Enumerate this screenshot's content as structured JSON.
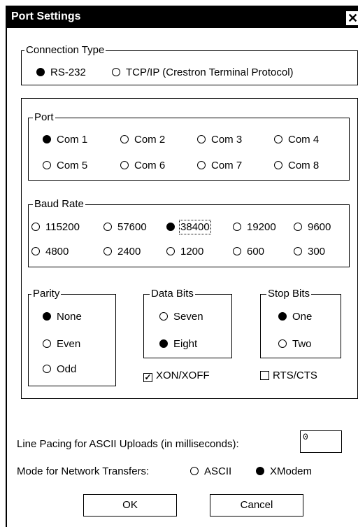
{
  "window": {
    "title": "Port Settings",
    "close_glyph": "✕"
  },
  "connection_type": {
    "legend": "Connection Type",
    "options": [
      "RS-232",
      "TCP/IP (Crestron Terminal Protocol)"
    ],
    "selected": "RS-232"
  },
  "port": {
    "legend": "Port",
    "options": [
      "Com 1",
      "Com 2",
      "Com 3",
      "Com 4",
      "Com 5",
      "Com 6",
      "Com 7",
      "Com 8"
    ],
    "selected": "Com 1"
  },
  "baud_rate": {
    "legend": "Baud Rate",
    "options": [
      "115200",
      "57600",
      "38400",
      "19200",
      "9600",
      "4800",
      "2400",
      "1200",
      "600",
      "300"
    ],
    "selected": "38400"
  },
  "parity": {
    "legend": "Parity",
    "options": [
      "None",
      "Even",
      "Odd"
    ],
    "selected": "None"
  },
  "data_bits": {
    "legend": "Data Bits",
    "options": [
      "Seven",
      "Eight"
    ],
    "selected": "Eight"
  },
  "stop_bits": {
    "legend": "Stop Bits",
    "options": [
      "One",
      "Two"
    ],
    "selected": "One"
  },
  "flow_control": {
    "xon_xoff": {
      "label": "XON/XOFF",
      "checked": true
    },
    "rts_cts": {
      "label": "RTS/CTS",
      "checked": false
    }
  },
  "line_pacing": {
    "label": "Line Pacing for ASCII Uploads (in milliseconds):",
    "value": "0"
  },
  "network_mode": {
    "label": "Mode for Network Transfers:",
    "options": [
      "ASCII",
      "XModem"
    ],
    "selected": "XModem"
  },
  "buttons": {
    "ok": "OK",
    "cancel": "Cancel"
  },
  "icons": {
    "radio_on": "radio-selected-icon",
    "radio_off": "radio-unselected-icon",
    "checkbox": "check-icon"
  }
}
